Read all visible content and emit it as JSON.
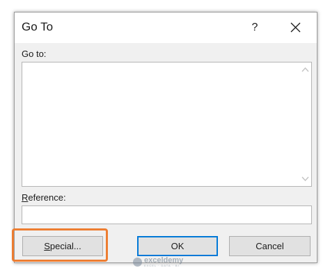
{
  "dialog": {
    "title": "Go To",
    "help_label": "?",
    "goto_label": "Go to:",
    "reference_label_hotkey": "R",
    "reference_label_rest": "eference:",
    "reference_value": ""
  },
  "buttons": {
    "special_hotkey": "S",
    "special_rest": "pecial...",
    "ok": "OK",
    "cancel": "Cancel"
  },
  "watermark": {
    "name": "exceldemy",
    "tagline": "EXCEL · DATA · BI"
  },
  "colors": {
    "highlight": "#ed7d31",
    "ok_focus_border": "#0078d7"
  }
}
